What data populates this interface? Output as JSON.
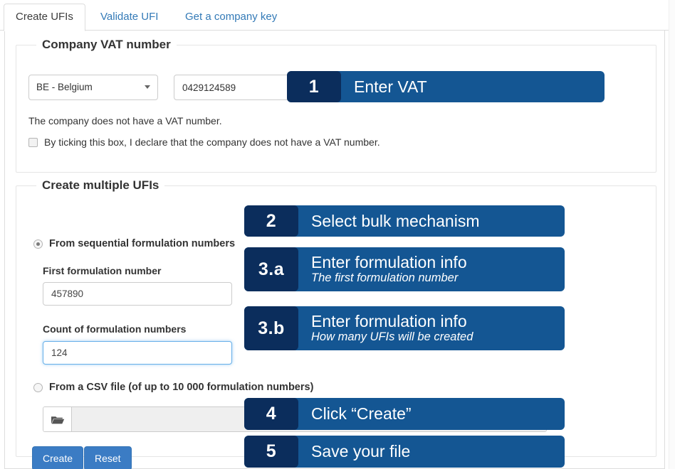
{
  "tabs": [
    {
      "label": "Create UFIs",
      "active": true
    },
    {
      "label": "Validate UFI",
      "active": false
    },
    {
      "label": "Get a company key",
      "active": false
    }
  ],
  "vat_section": {
    "legend": "Company VAT number",
    "country_select": {
      "value": "BE - Belgium",
      "icon": "chevron-down-icon"
    },
    "vat_input": {
      "value": "0429124589",
      "placeholder": ""
    },
    "helper_text": "The company does not have a VAT number.",
    "checkbox": {
      "label": "By ticking this box, I declare that the company does not have a VAT number.",
      "checked": false
    }
  },
  "multi_section": {
    "legend": "Create multiple UFIs",
    "option_sequential": {
      "label": "From sequential formulation numbers",
      "selected": true
    },
    "first_formulation": {
      "label": "First formulation number",
      "value": "457890",
      "placeholder": ""
    },
    "count_formulation": {
      "label": "Count of formulation numbers",
      "value": "124",
      "placeholder": ""
    },
    "option_csv": {
      "label": "From a CSV file (of up to 10 000 formulation numbers)",
      "selected": false
    },
    "file_picker": {
      "icon": "folder-open-icon",
      "filename": ""
    },
    "create_button": "Create",
    "reset_button": "Reset"
  },
  "callouts": [
    {
      "num": "1",
      "title": "Enter VAT",
      "sub": ""
    },
    {
      "num": "2",
      "title": "Select bulk mechanism",
      "sub": ""
    },
    {
      "num": "3.a",
      "title": "Enter formulation info",
      "sub": "The first formulation number"
    },
    {
      "num": "3.b",
      "title": "Enter formulation info",
      "sub": "How many UFIs will be created"
    },
    {
      "num": "4",
      "title": "Click “Create”",
      "sub": ""
    },
    {
      "num": "5",
      "title": "Save your file",
      "sub": ""
    }
  ],
  "colors": {
    "callout_body": "#145693",
    "callout_number": "#0b2d5c",
    "button_blue": "#3b7cc4",
    "tab_link": "#337ab7"
  }
}
